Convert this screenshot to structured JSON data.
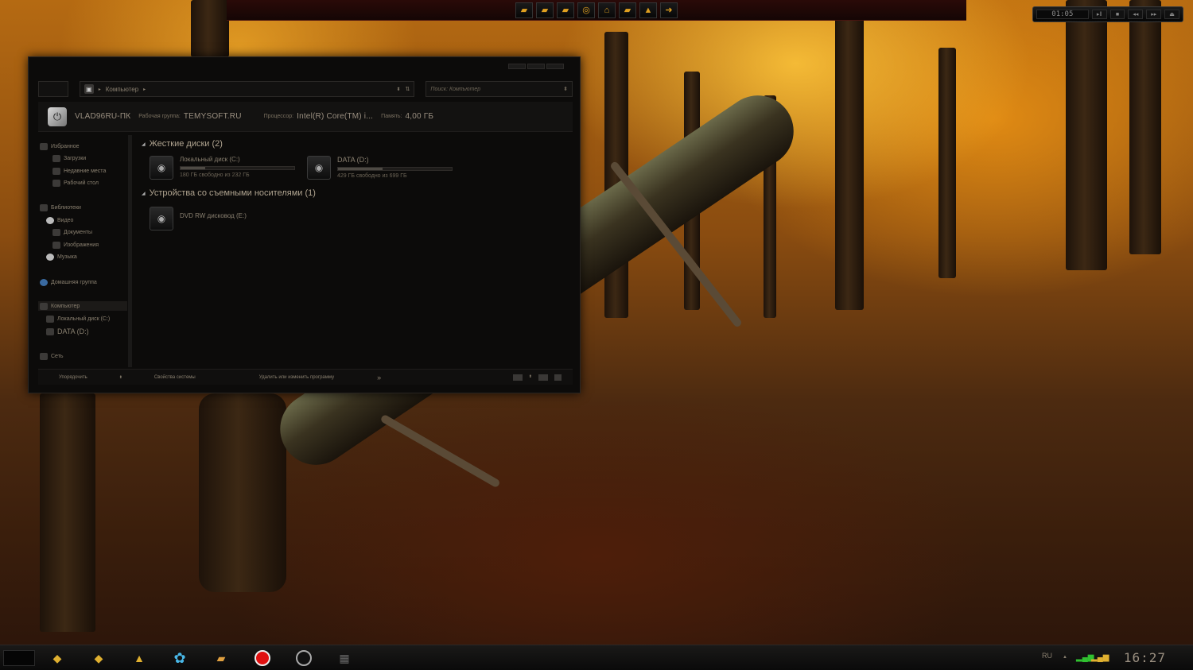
{
  "quicklaunch": {
    "buttons": [
      "folder-icon",
      "folder-icon",
      "folder-icon",
      "disc-icon",
      "home-icon",
      "folder-icon",
      "aimp-icon",
      "exit-icon"
    ]
  },
  "media": {
    "time": "01:05",
    "controls": [
      "▸‖",
      "■",
      "◂◂",
      "▸▸",
      "⏏"
    ]
  },
  "explorer": {
    "address": "Компьютер",
    "search_placeholder": "Поиск: Компьютер",
    "pc_name": "VLAD96RU-ПК",
    "workgroup_label": "Рабочая группа:",
    "workgroup": "TEMYSOFT.RU",
    "cpu_label": "Процессор:",
    "cpu": "Intel(R) Core(TM) i...",
    "memory_label": "Память:",
    "memory": "4,00 ГБ",
    "sidebar": {
      "favorites": "Избранное",
      "downloads": "Загрузки",
      "recent": "Недавние места",
      "desktop": "Рабочий стол",
      "libraries": "Библиотеки",
      "video": "Видео",
      "documents": "Документы",
      "pictures": "Изображения",
      "music": "Музыка",
      "homegroup": "Домашняя группа",
      "computer": "Компьютер",
      "local_disk": "Локальный диск (C:)",
      "data_disk": "DATA (D:)",
      "network": "Сеть"
    },
    "groups": {
      "hard_drives": "Жесткие диски (2)",
      "removable": "Устройства со съемными носителями (1)"
    },
    "drives": [
      {
        "name": "Локальный диск (C:)",
        "free": "180 ГБ свободно из 232 ГБ",
        "used_fraction": 0.22
      },
      {
        "name": "DATA (D:)",
        "free": "429 ГБ свободно из 699 ГБ",
        "used_fraction": 0.39
      }
    ],
    "dvd": {
      "name": "DVD RW дисковод (E:)"
    },
    "statusbar": {
      "organize": "Упорядочить",
      "system_properties": "Свойства системы",
      "uninstall": "Удалить или изменить программу",
      "more": "»"
    }
  },
  "taskbar": {
    "language": "RU",
    "clock": "16:27"
  }
}
